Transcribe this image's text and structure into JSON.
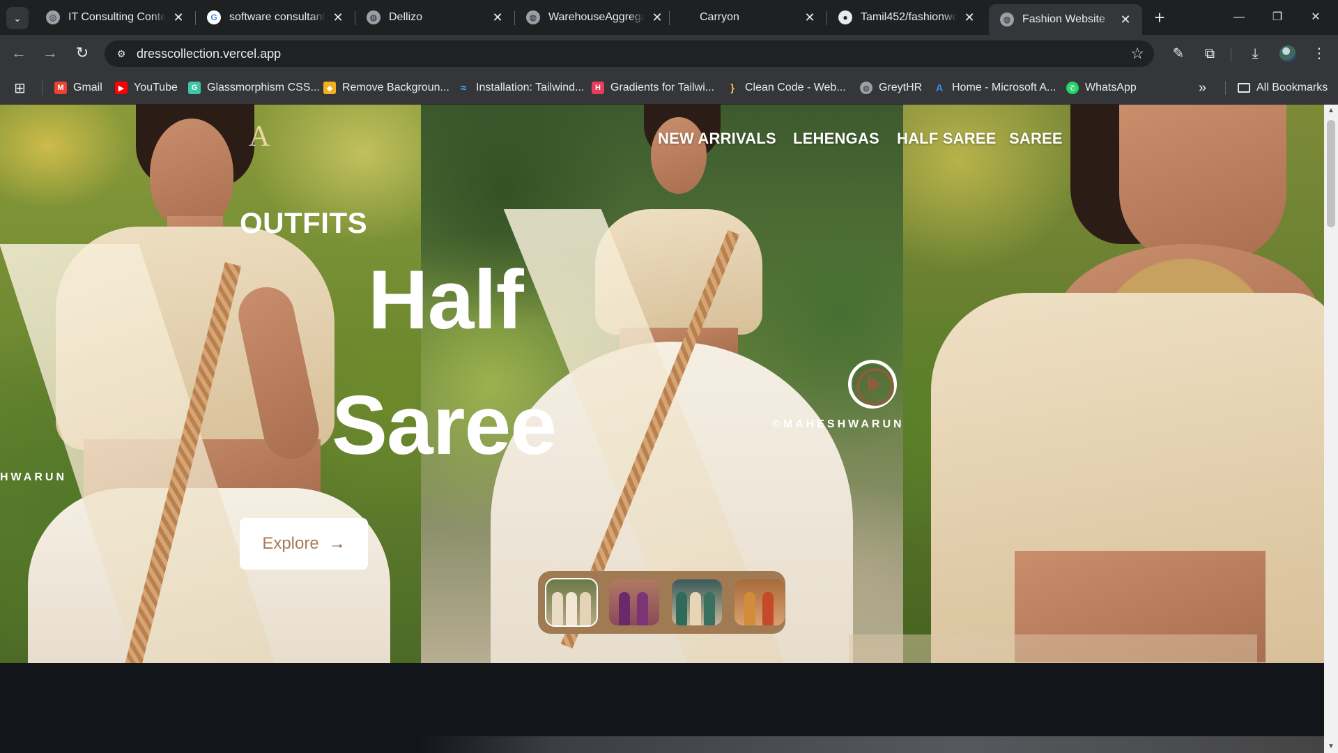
{
  "browser": {
    "tabs": [
      {
        "title": "IT Consulting Conten",
        "favicon": "openai-icon"
      },
      {
        "title": "software consultant -",
        "favicon": "google-icon"
      },
      {
        "title": "Dellizo",
        "favicon": "globe-icon"
      },
      {
        "title": "WarehouseAggregat",
        "favicon": "globe-icon"
      },
      {
        "title": "Carryon",
        "favicon": "none"
      },
      {
        "title": "Tamil452/fashionweb",
        "favicon": "github-icon"
      },
      {
        "title": "Fashion Website",
        "favicon": "globe-icon",
        "active": true
      }
    ],
    "url": "dresscollection.vercel.app",
    "bookmarks": [
      {
        "label": "Gmail",
        "color": "#ea4335"
      },
      {
        "label": "YouTube",
        "color": "#ff0000"
      },
      {
        "label": "Glassmorphism CSS...",
        "color": "#3ec6a8"
      },
      {
        "label": "Remove Backgroun...",
        "color": "#f2b01e"
      },
      {
        "label": "Installation: Tailwind...",
        "color": "#38bdf8"
      },
      {
        "label": "Gradients for Tailwi...",
        "color": "#e53e5b"
      },
      {
        "label": "Clean Code - Web...",
        "color": "#f0c24b"
      },
      {
        "label": "GreytHR",
        "color": "#9aa0a6"
      },
      {
        "label": "Home - Microsoft A...",
        "color": "#0078d4"
      },
      {
        "label": "WhatsApp",
        "color": "#25d366"
      }
    ],
    "all_bookmarks": "All Bookmarks",
    "more": "»"
  },
  "site": {
    "nav": [
      "NEW ARRIVALS",
      "LEHENGAS",
      "HALF SAREE",
      "SAREE"
    ],
    "brand_mark": "A",
    "kicker": "OUTFITS",
    "headline_1": "Half",
    "headline_2": "Saree",
    "explore_label": "Explore",
    "watermark_left": "HWARUN",
    "watermark_mid": "©MAHESHWARUN",
    "thumbnails": 4,
    "accent": "#a07a52"
  }
}
